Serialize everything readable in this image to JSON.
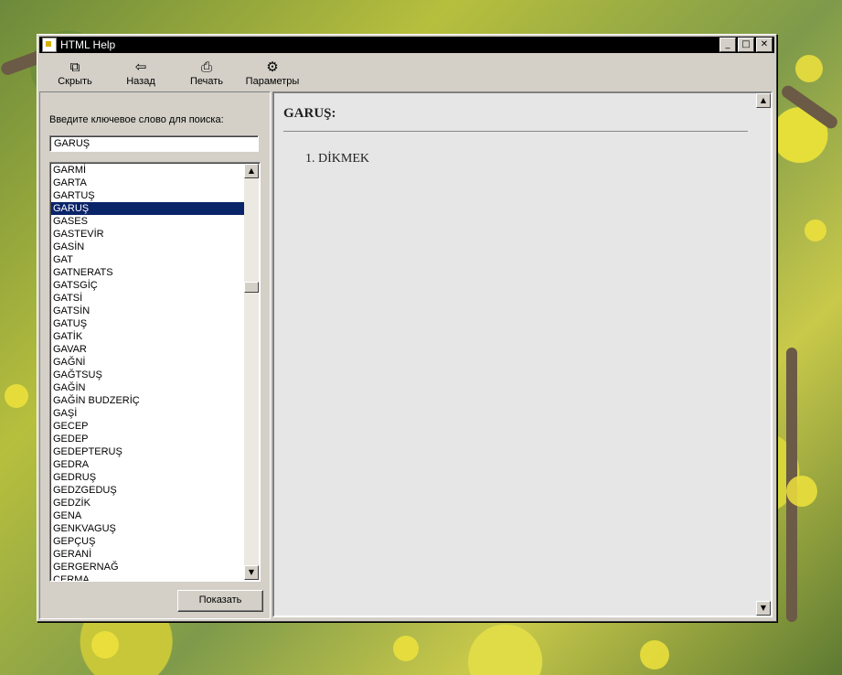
{
  "window": {
    "title": "HTML Help",
    "controls": {
      "minimize": "_",
      "maximize": "□",
      "close": "✕"
    }
  },
  "toolbar": {
    "buttons": [
      {
        "label": "Скрыть",
        "icon": "hide-pane-icon",
        "glyph": "⧉"
      },
      {
        "label": "Назад",
        "icon": "back-arrow-icon",
        "glyph": "⇦"
      },
      {
        "label": "Печать",
        "icon": "printer-icon",
        "glyph": "⎙"
      },
      {
        "label": "Параметры",
        "icon": "options-icon",
        "glyph": "⚙"
      }
    ]
  },
  "index": {
    "prompt": "Введите ключевое слово для поиска:",
    "keyword_value": "GARUŞ",
    "selected": "GARUŞ",
    "items": [
      "GARMİ",
      "GARTA",
      "GARTUŞ",
      "GARUŞ",
      "GASES",
      "GASTEVİR",
      "GASİN",
      "GAT",
      "GATNERATS",
      "GATSGİÇ",
      "GATSİ",
      "GATSİN",
      "GATUŞ",
      "GATİK",
      "GAVAR",
      "GAĞNİ",
      "GAĞTSUŞ",
      "GAĞİN",
      "GAĞİN BUDZERİÇ",
      "GAŞİ",
      "GECEP",
      "GEDEP",
      "GEDEPTERUŞ",
      "GEDRA",
      "GEDRUŞ",
      "GEDZGEDUŞ",
      "GEDZİK",
      "GENA",
      "GENKVAGUŞ",
      "GEPÇUŞ",
      "GERANİ",
      "GERGERNAĞ",
      "CERMA"
    ],
    "show_button": "Показать"
  },
  "topic": {
    "heading": "GARUŞ:",
    "definitions": [
      "DİKMEK"
    ]
  },
  "scroll_glyphs": {
    "up": "▲",
    "down": "▼"
  }
}
